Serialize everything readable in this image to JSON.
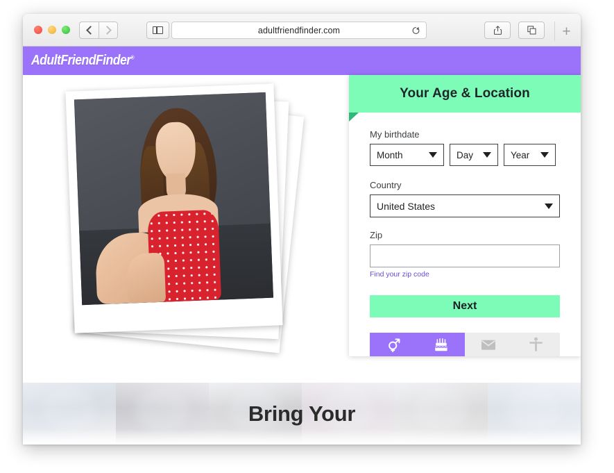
{
  "browser": {
    "url": "adultfriendfinder.com",
    "back_label": "Back",
    "forward_label": "Forward",
    "sidebar_label": "Show Sidebar",
    "reload_label": "Reload",
    "share_label": "Share",
    "tabs_label": "Show Tab Overview",
    "new_tab_label": "+"
  },
  "site": {
    "logo_text": "AdultFriendFinder",
    "logo_mark": "®",
    "header_color": "#9b72fa"
  },
  "panel": {
    "title": "Your Age & Location",
    "accent_color": "#7dfcb8",
    "birthdate": {
      "label": "My birthdate",
      "month": "Month",
      "day": "Day",
      "year": "Year"
    },
    "country": {
      "label": "Country",
      "value": "United States"
    },
    "zip": {
      "label": "Zip",
      "value": "",
      "placeholder": "",
      "help_link": "Find your zip code"
    },
    "next_label": "Next",
    "steps": [
      {
        "icon": "gender-icon",
        "name": "gender",
        "active": true
      },
      {
        "icon": "birthday-cake-icon",
        "name": "age",
        "active": true
      },
      {
        "icon": "envelope-icon",
        "name": "email",
        "active": false
      },
      {
        "icon": "body-type-icon",
        "name": "appearance",
        "active": false
      }
    ]
  },
  "banner": {
    "heading": "Bring Your"
  }
}
